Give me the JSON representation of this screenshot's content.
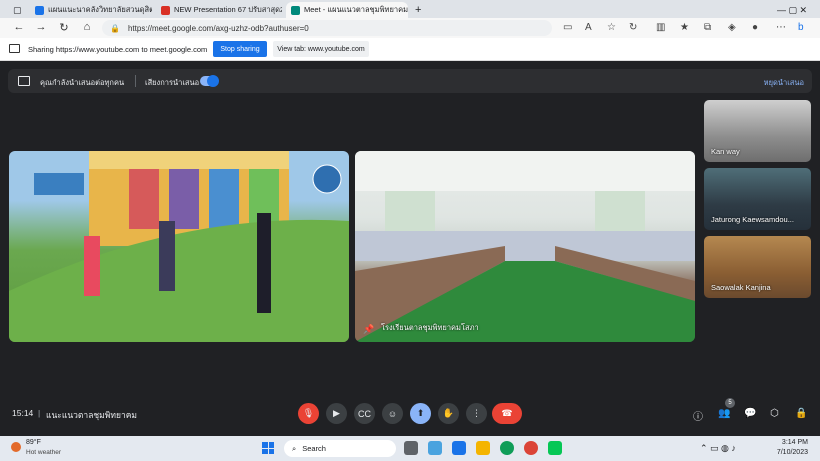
{
  "browser": {
    "tabs": [
      {
        "label": "แผนแนะนาคลังวิทยาลัยสวนดุสิต",
        "color": "#1a73e8"
      },
      {
        "label": "NEW Presentation 67 ปรับสาสุด23",
        "color": "#d93025"
      },
      {
        "label": "Meet - แผนแนวตาลชุมพิทยาคม",
        "color": "#00897b"
      }
    ],
    "url": "https://meet.google.com/axg-uzhz-odb?authuser=0"
  },
  "sharing_bar": {
    "text": "Sharing https://www.youtube.com to meet.google.com",
    "stop_label": "Stop sharing",
    "view_tab_label": "View tab: www.youtube.com"
  },
  "presenting_bar": {
    "label": "คุณกำลังนำเสนอต่อทุกคน",
    "audio_label": "เสียงการนำเสนอ",
    "stop_label": "หยุดนำเสนอ"
  },
  "tiles": {
    "main_video_caption": "",
    "room_name": "โรงเรียนตาลชุมพิทยาคมโสภา"
  },
  "participants": [
    {
      "name": "Kan way"
    },
    {
      "name": "Jaturong Kaewsamdou..."
    },
    {
      "name": "Saowalak Kanjina"
    }
  ],
  "meeting": {
    "time": "15:14",
    "separator": "|",
    "name": "แนะแนวตาลชุมพิทยาคม",
    "participant_count": "5"
  },
  "taskbar": {
    "weather_temp": "89°F",
    "weather_desc": "Hot weather",
    "search_placeholder": "Search",
    "time": "3:14 PM",
    "date": "7/10/2023"
  },
  "colors": {
    "meet_bg": "#202124",
    "accent": "#8ab4f8",
    "danger": "#ea4335",
    "primary": "#1a73e8"
  }
}
